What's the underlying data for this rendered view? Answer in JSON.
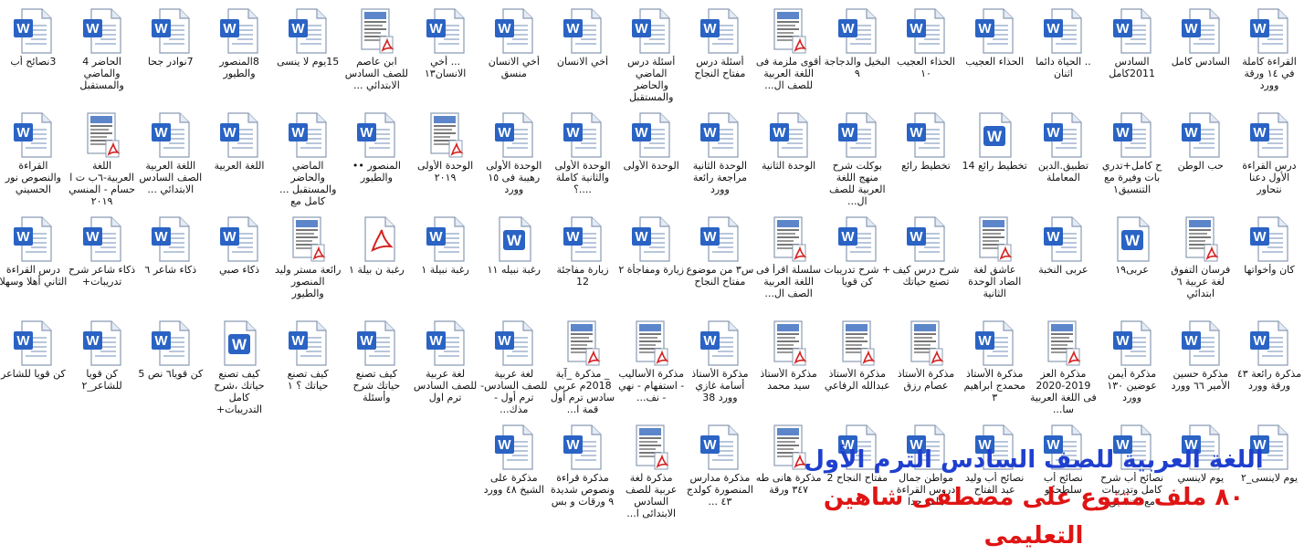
{
  "files": [
    {
      "label": "القراءة كاملة في ١٤ ورقة وورد",
      "icon": "word"
    },
    {
      "label": "السادس كامل",
      "icon": "word"
    },
    {
      "label": "السادس 2011كامل",
      "icon": "word"
    },
    {
      "label": ".. الحياة دائما اثنان",
      "icon": "word"
    },
    {
      "label": "الحذاء العجيب",
      "icon": "word"
    },
    {
      "label": "الحذاء العجيب ١٠",
      "icon": "word"
    },
    {
      "label": "البخيل والدجاجة ٩",
      "icon": "word"
    },
    {
      "label": "أقوى ملزمة فى اللغة العربية للصف ال...",
      "icon": "pdf-doc"
    },
    {
      "label": "أسئلة درس مفتاح النجاح",
      "icon": "word"
    },
    {
      "label": "أسئلة درس الماضي والحاضر والمستقبل",
      "icon": "word"
    },
    {
      "label": "أخي الانسان",
      "icon": "word"
    },
    {
      "label": "أخي الانسان منسق",
      "icon": "word"
    },
    {
      "label": "... أخي الانسان١٣",
      "icon": "word"
    },
    {
      "label": "ابن عاصم للصف السادس الابتدائي ...",
      "icon": "pdf-doc"
    },
    {
      "label": "15يوم لا ينسى",
      "icon": "word"
    },
    {
      "label": "8المنصور والطيور",
      "icon": "word"
    },
    {
      "label": "7نوادر جحا",
      "icon": "word"
    },
    {
      "label": "الحاضر 4 والماضي والمستقبل",
      "icon": "word"
    },
    {
      "label": "3نصائح أب",
      "icon": "word"
    },
    {
      "label": "درس القراءة الأول دعنا نتحاور",
      "icon": "word"
    },
    {
      "label": "حب الوطن",
      "icon": "word"
    },
    {
      "label": "ح كامل+تدري بات وفيرة مع التنسيق١",
      "icon": "word"
    },
    {
      "label": "تطبيق.الدين المعاملة",
      "icon": "word"
    },
    {
      "label": "تخطيط رائع 14",
      "icon": "word-w"
    },
    {
      "label": "تخطيط رائع",
      "icon": "word"
    },
    {
      "label": "بوكلت شرح منهج اللغة العربية للصف ال...",
      "icon": "word"
    },
    {
      "label": "الوحدة الثانية",
      "icon": "word"
    },
    {
      "label": "الوحدة الثانية مراجعة رائعة وورد",
      "icon": "word"
    },
    {
      "label": "الوحدة الأولى",
      "icon": "word"
    },
    {
      "label": "الوحدة الأولى والثانية كاملة ....؟",
      "icon": "word"
    },
    {
      "label": "الوحدة الأولى رهيبة فى ١٥ وورد",
      "icon": "word"
    },
    {
      "label": "الوحدة الأولى ٢٠١٩",
      "icon": "pdf-doc"
    },
    {
      "label": "المنصور •• والطيور",
      "icon": "word"
    },
    {
      "label": "الماضي والحاضر والمستقبل ... كامل مع",
      "icon": "word"
    },
    {
      "label": "اللغة العربية",
      "icon": "word"
    },
    {
      "label": "اللغة العربية الصف السادس الابتدائي ...",
      "icon": "word"
    },
    {
      "label": "اللغة العربية-٦ب ت ا حسام - المنسي ٢٠١٩",
      "icon": "pdf-doc"
    },
    {
      "label": "القراءة والنصوص نور الحسيني",
      "icon": "word"
    },
    {
      "label": "كان وأخواتها",
      "icon": "word"
    },
    {
      "label": "فرسان التفوق لغة عربية ٦ ابتدائي",
      "icon": "pdf-doc"
    },
    {
      "label": "عربى١٩",
      "icon": "word-w"
    },
    {
      "label": "عربى النخبة",
      "icon": "word"
    },
    {
      "label": "عاشق لغة الضاد الوحدة الثانية",
      "icon": "pdf-doc"
    },
    {
      "label": "شرح درس كيف تصنع حياتك",
      "icon": "word"
    },
    {
      "label": "+ شرح تدريبات كن قويا",
      "icon": "word"
    },
    {
      "label": "سلسلة اقرأ فى اللغة العربية الصف ال...",
      "icon": "pdf-doc"
    },
    {
      "label": "س٣ من موضوع مفتاح النجاح",
      "icon": "word"
    },
    {
      "label": "زيارة ومفاجأة ٢",
      "icon": "word"
    },
    {
      "label": "زيارة مفاجئة 12",
      "icon": "word"
    },
    {
      "label": "رغبة نبيله ١١",
      "icon": "word-w"
    },
    {
      "label": "رغبة نبيلة ١",
      "icon": "word"
    },
    {
      "label": "رغبة ن بيلة ١",
      "icon": "pdf"
    },
    {
      "label": "رائعة مستر وليد المنصور والطيور",
      "icon": "pdf-doc"
    },
    {
      "label": "ذكاء صبي",
      "icon": "word"
    },
    {
      "label": "ذكاء شاعر ٦",
      "icon": "word"
    },
    {
      "label": "ذكاء شاعر شرح تدريبات+",
      "icon": "word"
    },
    {
      "label": "درس القراءة الثاني أهلا وسهلا",
      "icon": "word"
    },
    {
      "label": "مذكرة رائعة ٤٣ ورقة وورد",
      "icon": "word"
    },
    {
      "label": "مذكرة حسين الأمير ٦٦ وورد",
      "icon": "word"
    },
    {
      "label": "مذكرة أيمن عوضين ١٣٠ وورد",
      "icon": "word"
    },
    {
      "label": "مذكرة العز 2019-2020 فى اللغة العربية سا...",
      "icon": "pdf-doc"
    },
    {
      "label": "مذكرة الأستاذ محمدج ابراهيم ٣",
      "icon": "word"
    },
    {
      "label": "مذكرة الأستاذ عصام رزق",
      "icon": "pdf-doc"
    },
    {
      "label": "مذكرة الأستاذ عبدالله الرفاعي",
      "icon": "pdf-doc"
    },
    {
      "label": "مذكرة الأستاذ سيد محمد",
      "icon": "pdf-doc"
    },
    {
      "label": "مذكرة الأستاذ أسامة غازي وورد 38",
      "icon": "word"
    },
    {
      "label": "مذكرة الأساليب - استفهام - نهي - نف...",
      "icon": "pdf-doc"
    },
    {
      "label": "_ مذكرة _آية 2018م عربي سادس ترم أول قمة ا...",
      "icon": "pdf-doc"
    },
    {
      "label": "لغة عربية للصف السادس-ترم أول - مذك...",
      "icon": "word"
    },
    {
      "label": "لغة عربية للصف السادس ترم اول",
      "icon": "word"
    },
    {
      "label": "كيف تصنع حياتك شرح وأسئلة",
      "icon": "word"
    },
    {
      "label": "كيف تصنع حياتك ؟ ١",
      "icon": "word"
    },
    {
      "label": "كيف تصنع حياتك ،شرح كامل التدريبات+",
      "icon": "word-w"
    },
    {
      "label": "كن قويا٦ نص 5",
      "icon": "word"
    },
    {
      "label": "كن قويا للشاعر_٢",
      "icon": "word"
    },
    {
      "label": "كن قويا للشاعر",
      "icon": "word"
    },
    {
      "label": "يوم لاينسى_٢",
      "icon": "word"
    },
    {
      "label": "يوم لاينسي",
      "icon": "word"
    },
    {
      "label": "نصائح أب شرح كامل وتدريبات مع التنسيق",
      "icon": "word"
    },
    {
      "label": "نصائح أب سلطحكو",
      "icon": "word"
    },
    {
      "label": "نصائح أب وليد عبد الفتاح",
      "icon": "word"
    },
    {
      "label": "مواطن جمال دروس القراءة هامة جدا",
      "icon": "word"
    },
    {
      "label": "مفتاح النجاح 2",
      "icon": "word"
    },
    {
      "label": "مذكرة هانى طه ٣٤٧ ورقة",
      "icon": "pdf-doc"
    },
    {
      "label": "مذكرة مدارس المنصورة كولدج ٤٣ ...",
      "icon": "word"
    },
    {
      "label": "مذكرة لغة عربية للصف السادس الابتدائى ا...",
      "icon": "pdf-doc"
    },
    {
      "label": "مذكرة قراءة ونصوص شديدة ٩ ورقات و بس",
      "icon": "word"
    },
    {
      "label": "مذكرة على الشيخ ٤٨ وورد",
      "icon": "word"
    }
  ],
  "banner": {
    "line1": "اللغة العربية للصف السادس الترم الأول",
    "line2": "٨٠ ملف متنوع على مصطفى شاهين التعليمى"
  }
}
